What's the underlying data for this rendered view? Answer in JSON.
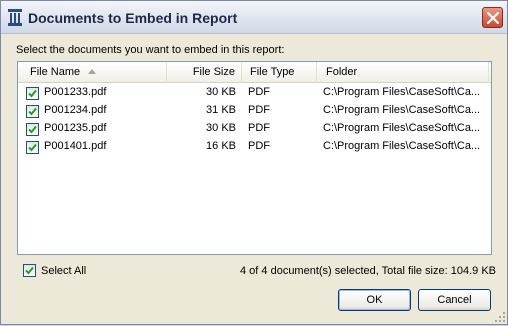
{
  "window": {
    "title": "Documents to Embed in Report"
  },
  "instruction": "Select the documents you want to embed in this report:",
  "columns": {
    "name": "File Name",
    "size": "File Size",
    "type": "File Type",
    "folder": "Folder"
  },
  "rows": [
    {
      "name": "P001233.pdf",
      "size": "30 KB",
      "type": "PDF",
      "folder": "C:\\Program Files\\CaseSoft\\Ca...",
      "checked": true
    },
    {
      "name": "P001234.pdf",
      "size": "31 KB",
      "type": "PDF",
      "folder": "C:\\Program Files\\CaseSoft\\Ca...",
      "checked": true
    },
    {
      "name": "P001235.pdf",
      "size": "30 KB",
      "type": "PDF",
      "folder": "C:\\Program Files\\CaseSoft\\Ca...",
      "checked": true
    },
    {
      "name": "P001401.pdf",
      "size": "16 KB",
      "type": "PDF",
      "folder": "C:\\Program Files\\CaseSoft\\Ca...",
      "checked": true
    }
  ],
  "select_all": {
    "label": "Select All",
    "checked": true
  },
  "status": "4 of 4 document(s) selected, Total file size: 104.9 KB",
  "buttons": {
    "ok": "OK",
    "cancel": "Cancel"
  },
  "icons": {
    "app": "report-pillar-icon",
    "close": "close-icon",
    "check": "check-icon",
    "sort": "sort-ascending-icon",
    "grip": "resize-grip-icon"
  },
  "colors": {
    "checkmark": "#21a121",
    "close_button": "#c74a32",
    "list_border": "#7f9db9"
  }
}
